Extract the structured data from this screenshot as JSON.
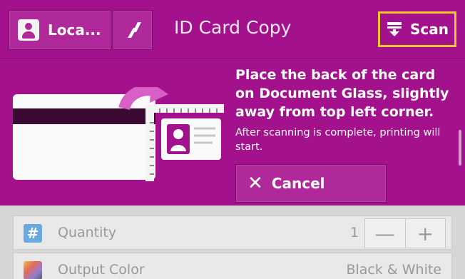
{
  "header": {
    "user_label": "Loca...",
    "title": "ID Card Copy",
    "scan_label": "Scan"
  },
  "instructions": {
    "title": "Place the back of the card on Document Glass, slightly away from top left corner.",
    "subtitle": "After scanning is complete, printing will start."
  },
  "cancel": {
    "label": "Cancel"
  },
  "settings": {
    "quantity": {
      "label": "Quantity",
      "value": "1"
    },
    "output_color": {
      "label": "Output Color",
      "value": "Black & White"
    }
  },
  "colors": {
    "accent": "#a3128c",
    "highlight": "#f7c62e"
  },
  "icons": [
    "user-icon",
    "slash-icon",
    "scan-icon",
    "card-icon",
    "arrow-icon",
    "ruler-icon",
    "id-card-icon",
    "close-icon",
    "hash-icon",
    "color-icon"
  ]
}
